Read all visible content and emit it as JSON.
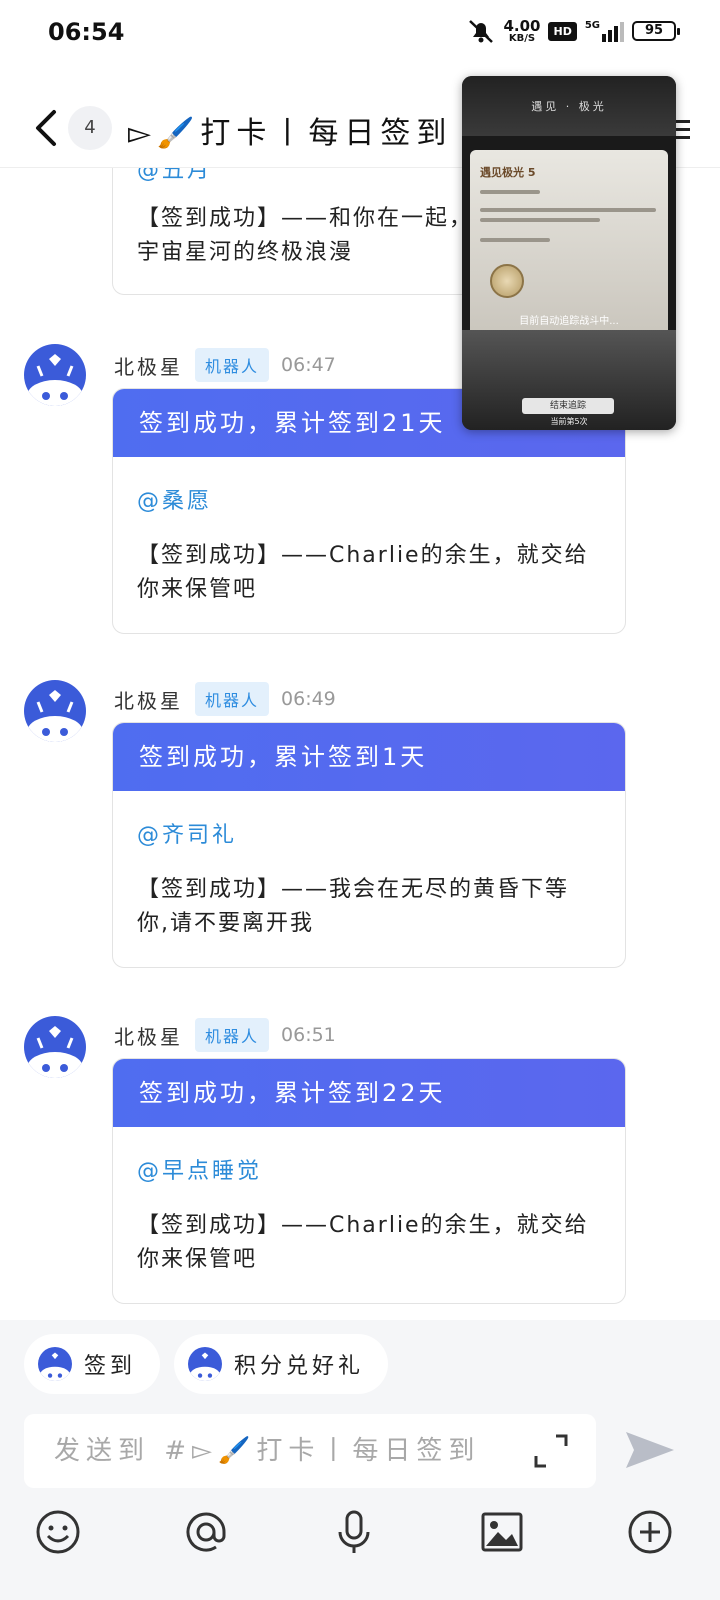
{
  "status_bar": {
    "time": "06:54",
    "speed_value": "4.00",
    "speed_unit": "KB/S",
    "hd": "HD",
    "network": "5G",
    "battery": "95"
  },
  "header": {
    "unread_count": "4",
    "title": "▻🖌️打卡丨每日签到"
  },
  "partial_message": {
    "mention": "@丑月",
    "text": "【签到成功】——和你在一起，就是远胜于宇宙星河的终极浪漫"
  },
  "messages": [
    {
      "sender": "北极星",
      "tag": "机器人",
      "time": "06:47",
      "title": "签到成功，累计签到21天",
      "mention": "@桑愿",
      "text": "【签到成功】——Charlie的余生，就交给你来保管吧"
    },
    {
      "sender": "北极星",
      "tag": "机器人",
      "time": "06:49",
      "title": "签到成功，累计签到1天",
      "mention": "@齐司礼",
      "text": "【签到成功】——我会在无尽的黄昏下等你,请不要离开我"
    },
    {
      "sender": "北极星",
      "tag": "机器人",
      "time": "06:51",
      "title": "签到成功，累计签到22天",
      "mention": "@早点睡觉",
      "text": "【签到成功】——Charlie的余生，就交给你来保管吧"
    }
  ],
  "floating_video": {
    "title": "遇见 · 极光",
    "panel_title": "遇见极光 5",
    "status": "目前自动追踪战斗中...",
    "button": "结束追踪",
    "count": "当前第5次"
  },
  "quick_actions": [
    "签到",
    "积分兑好礼"
  ],
  "input": {
    "placeholder": "发送到 #▻🖌️打卡丨每日签到"
  },
  "colors": {
    "card_header": "#5468ef",
    "mention": "#2c8bd8",
    "bot_tag_bg": "#e3f0fc",
    "avatar": "#3b5bd9"
  },
  "icons": {
    "toolbar": [
      "emoji-icon",
      "at-icon",
      "microphone-icon",
      "image-icon",
      "plus-icon"
    ]
  }
}
